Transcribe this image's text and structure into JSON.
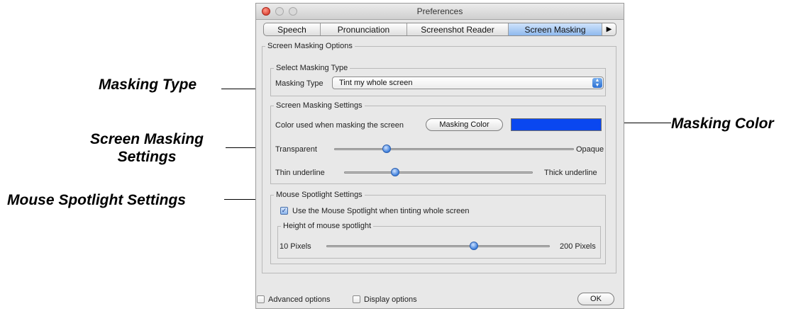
{
  "callouts": {
    "masking_type": "Masking Type",
    "screen_masking_settings_line1": "Screen Masking",
    "screen_masking_settings_line2": "Settings",
    "mouse_spotlight_settings": "Mouse Spotlight Settings",
    "masking_color": "Masking Color"
  },
  "window": {
    "title": "Preferences"
  },
  "tabs": [
    {
      "label": "Speech"
    },
    {
      "label": "Pronunciation"
    },
    {
      "label": "Screenshot Reader"
    },
    {
      "label": "Screen Masking",
      "active": true
    }
  ],
  "tab_overflow_icon": "triangle-right-icon",
  "options_group": {
    "label": "Screen Masking Options"
  },
  "select_type": {
    "label": "Select Masking Type",
    "field_label": "Masking Type",
    "selected_value": "Tint my whole screen"
  },
  "masking_settings": {
    "label": "Screen Masking Settings",
    "color_label": "Color used when masking the screen",
    "color_button": "Masking Color",
    "color_value": "#0a47f0",
    "opacity": {
      "min_label": "Transparent",
      "max_label": "Opaque",
      "value": 0.22
    },
    "underline": {
      "min_label": "Thin underline",
      "max_label": "Thick underline",
      "value": 0.27
    }
  },
  "spotlight": {
    "label": "Mouse Spotlight Settings",
    "checkbox_label": "Use the Mouse Spotlight when tinting whole screen",
    "checked": true,
    "height_group": {
      "label": "Height of mouse spotlight",
      "min_label": "10 Pixels",
      "max_label": "200 Pixels",
      "value": 0.66
    }
  },
  "footer": {
    "advanced_label": "Advanced options",
    "display_label": "Display options",
    "ok_label": "OK"
  }
}
